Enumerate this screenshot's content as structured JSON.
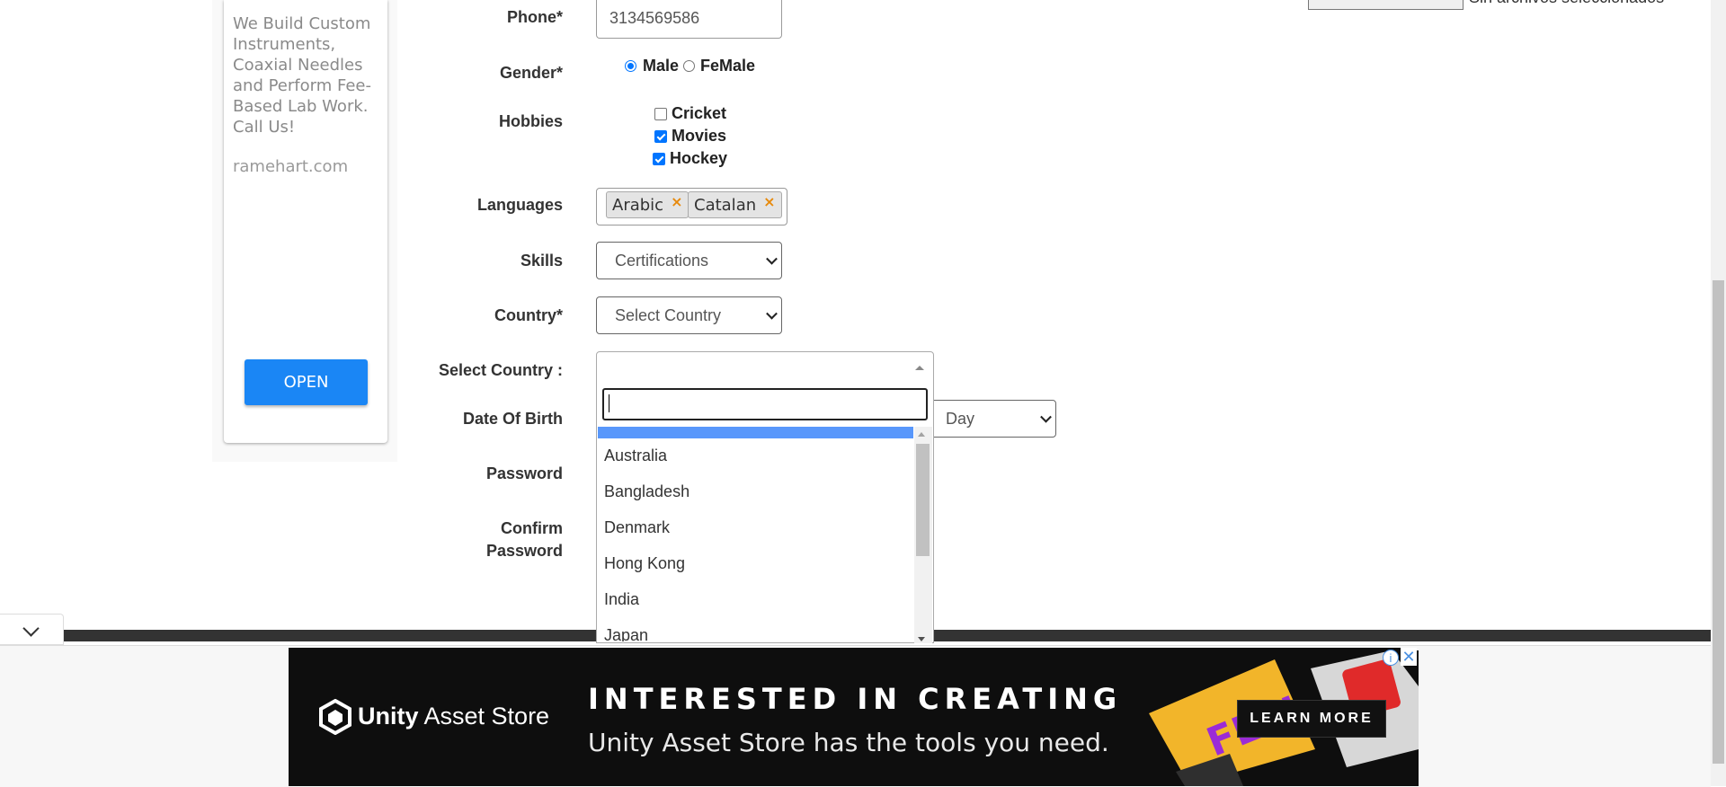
{
  "sidebar_ad": {
    "text": "We Build Custom Instruments, Coaxial Needles and Perform Fee-Based Lab Work. Call Us!",
    "domain": "ramehart.com",
    "open_label": "OPEN"
  },
  "form": {
    "phone": {
      "label": "Phone*",
      "value": "3134569586"
    },
    "gender": {
      "label": "Gender*",
      "options": [
        "Male",
        "FeMale"
      ],
      "selected": "Male"
    },
    "hobbies": {
      "label": "Hobbies",
      "items": [
        {
          "label": "Cricket",
          "checked": false
        },
        {
          "label": "Movies",
          "checked": true
        },
        {
          "label": "Hockey",
          "checked": true
        }
      ]
    },
    "languages": {
      "label": "Languages",
      "tags": [
        "Arabic",
        "Catalan"
      ],
      "remove_glyph": "×"
    },
    "skills": {
      "label": "Skills",
      "value": "Certifications"
    },
    "country": {
      "label": "Country*",
      "value": "Select Country"
    },
    "select_country": {
      "label": "Select Country :",
      "search_value": "",
      "options": [
        "Australia",
        "Bangladesh",
        "Denmark",
        "Hong Kong",
        "India",
        "Japan"
      ]
    },
    "dob": {
      "label": "Date Of Birth",
      "day_value": "Day"
    },
    "password": {
      "label": "Password"
    },
    "confirm_password": {
      "label_line1": "Confirm",
      "label_line2": "Password"
    }
  },
  "bottom_ad": {
    "brand_bold": "Unity",
    "brand_rest": " Asset Store",
    "headline": "INTERESTED IN CREATING?",
    "subline": "Unity Asset Store has the tools you need.",
    "cta": "LEARN MORE",
    "art_word": "FEEL",
    "info_glyph": "i",
    "close_glyph": "✕"
  },
  "top_file": {
    "status": "Sin archivos seleccionados"
  },
  "colors": {
    "accent": "#0075ff",
    "open_button": "#1a86f5",
    "select2_highlight": "#5897fb",
    "tag_remove": "#e7890b"
  }
}
